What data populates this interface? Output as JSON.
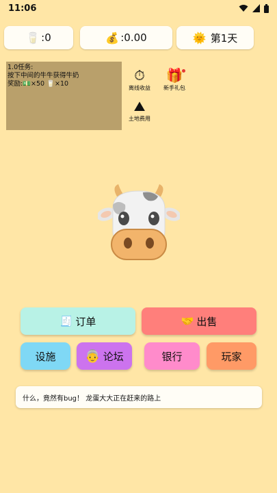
{
  "status_bar": {
    "time": "11:06"
  },
  "stats": {
    "milk": {
      "icon": "🥛",
      "value": ":0"
    },
    "money": {
      "icon": "💰",
      "value": ":0.00"
    },
    "day": {
      "icon": "🌞",
      "value": "第1天"
    }
  },
  "task": {
    "title": "1.0任务:",
    "description": "按下中间的牛牛获得牛奶",
    "reward_label": "奖励:",
    "reward_cash_icon": "💵",
    "reward_cash": "×50",
    "reward_milk_icon": "🥛",
    "reward_milk": "×10"
  },
  "side_icons": {
    "offline_income": {
      "icon": "stopwatch-icon",
      "glyph": "⏱",
      "label": "离线收益"
    },
    "newbie_gift": {
      "icon": "gift-icon",
      "glyph": "🎁",
      "label": "新手礼包"
    },
    "land_fee": {
      "icon": "land-icon",
      "glyph": "⛰",
      "label": "土地费用"
    }
  },
  "buttons": {
    "orders": {
      "icon": "🧾",
      "label": "订单",
      "color": "#B8F2E6"
    },
    "sell": {
      "icon": "🤝",
      "label": "出售",
      "color": "#FF7F7B"
    },
    "facilities": {
      "label": "设施",
      "color": "#7FD8F5"
    },
    "forum": {
      "icon": "👵",
      "label": "论坛",
      "color": "#CC73EE"
    },
    "bank": {
      "label": "银行",
      "color": "#FF8BCB"
    },
    "players": {
      "label": "玩家",
      "color": "#FF9A66"
    }
  },
  "message": "什么，竟然有bug！ 龙蛋大大正在赶来的路上"
}
